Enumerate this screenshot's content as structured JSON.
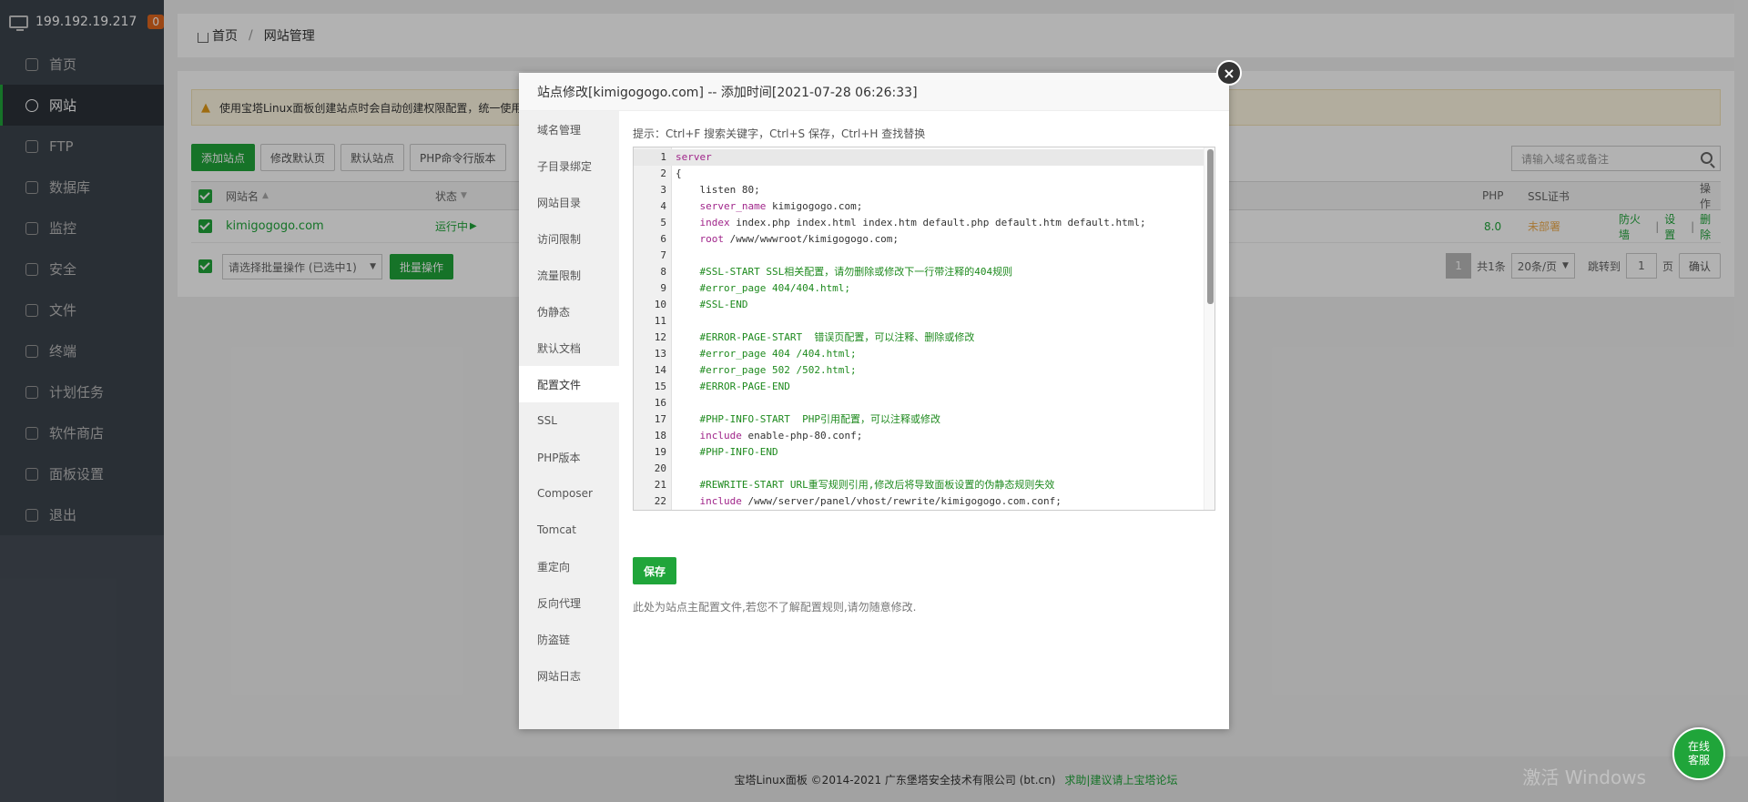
{
  "sidebar": {
    "ip": "199.192.19.217",
    "badge": "0",
    "items": [
      {
        "label": "首页",
        "icon": "home-icon"
      },
      {
        "label": "网站",
        "icon": "globe-icon",
        "active": true
      },
      {
        "label": "FTP",
        "icon": "ftp-icon"
      },
      {
        "label": "数据库",
        "icon": "database-icon"
      },
      {
        "label": "监控",
        "icon": "monitor-icon"
      },
      {
        "label": "安全",
        "icon": "shield-icon"
      },
      {
        "label": "文件",
        "icon": "folder-icon"
      },
      {
        "label": "终端",
        "icon": "terminal-icon"
      },
      {
        "label": "计划任务",
        "icon": "calendar-icon"
      },
      {
        "label": "软件商店",
        "icon": "apps-icon"
      },
      {
        "label": "面板设置",
        "icon": "gear-icon"
      },
      {
        "label": "退出",
        "icon": "logout-icon"
      }
    ]
  },
  "breadcrumb": {
    "home": "首页",
    "current": "网站管理"
  },
  "warning": "使用宝塔Linux面板创建站点时会自动创建权限配置，统一使用",
  "toolbar": {
    "add_site": "添加站点",
    "modify_default_page": "修改默认页",
    "default_site": "默认站点",
    "php_cli_version": "PHP命令行版本"
  },
  "search": {
    "placeholder": "请输入域名或备注"
  },
  "table": {
    "headers": {
      "name": "网站名",
      "status": "状态",
      "php": "PHP",
      "ssl": "SSL证书",
      "ops": "操作"
    },
    "row": {
      "name": "kimigogogo.com",
      "status": "运行中",
      "php": "8.0",
      "ssl": "未部署",
      "firewall": "防火墙",
      "settings": "设置",
      "delete": "删除"
    }
  },
  "batch": {
    "select": "请选择批量操作 (已选中1)",
    "button": "批量操作"
  },
  "pagination": {
    "current": "1",
    "total": "共1条",
    "per_page": "20条/页",
    "goto": "跳转到",
    "page_value": "1",
    "page_unit": "页",
    "confirm": "确认"
  },
  "footer": {
    "copyright": "宝塔Linux面板 ©2014-2021 广东堡塔安全技术有限公司 (bt.cn)",
    "link": "求助|建议请上宝塔论坛"
  },
  "watermark": "激活 Windows",
  "online_service": {
    "line1": "在线",
    "line2": "客服"
  },
  "modal": {
    "title": "站点修改[kimigogogo.com] -- 添加时间[2021-07-28 06:26:33]",
    "close": "×",
    "menu": [
      "域名管理",
      "子目录绑定",
      "网站目录",
      "访问限制",
      "流量限制",
      "伪静态",
      "默认文档",
      "配置文件",
      "SSL",
      "PHP版本",
      "Composer",
      "Tomcat",
      "重定向",
      "反向代理",
      "防盗链",
      "网站日志"
    ],
    "active_menu": "配置文件",
    "hint": "提示：Ctrl+F 搜索关键字，Ctrl+S 保存，Ctrl+H 查找替换",
    "save": "保存",
    "note": "此处为站点主配置文件,若您不了解配置规则,请勿随意修改.",
    "code": [
      {
        "n": "1",
        "parts": [
          {
            "t": "server",
            "c": "kw"
          }
        ]
      },
      {
        "n": "2",
        "parts": [
          {
            "t": "{",
            "c": ""
          }
        ]
      },
      {
        "n": "3",
        "parts": [
          {
            "t": "    listen 80;",
            "c": ""
          }
        ]
      },
      {
        "n": "4",
        "parts": [
          {
            "t": "    ",
            "c": ""
          },
          {
            "t": "server_name",
            "c": "kw"
          },
          {
            "t": " kimigogogo.com;",
            "c": ""
          }
        ]
      },
      {
        "n": "5",
        "parts": [
          {
            "t": "    ",
            "c": ""
          },
          {
            "t": "index",
            "c": "kw"
          },
          {
            "t": " index.php index.html index.htm default.php default.htm default.html;",
            "c": ""
          }
        ]
      },
      {
        "n": "6",
        "parts": [
          {
            "t": "    ",
            "c": ""
          },
          {
            "t": "root",
            "c": "kw"
          },
          {
            "t": " /www/wwwroot/kimigogogo.com;",
            "c": ""
          }
        ]
      },
      {
        "n": "7",
        "parts": [
          {
            "t": "",
            "c": ""
          }
        ]
      },
      {
        "n": "8",
        "parts": [
          {
            "t": "    #SSL-START SSL相关配置，请勿删除或修改下一行带注释的404规则",
            "c": "cm"
          }
        ]
      },
      {
        "n": "9",
        "parts": [
          {
            "t": "    #error_page 404/404.html;",
            "c": "cm"
          }
        ]
      },
      {
        "n": "10",
        "parts": [
          {
            "t": "    #SSL-END",
            "c": "cm"
          }
        ]
      },
      {
        "n": "11",
        "parts": [
          {
            "t": "",
            "c": ""
          }
        ]
      },
      {
        "n": "12",
        "parts": [
          {
            "t": "    #ERROR-PAGE-START  错误页配置，可以注释、删除或修改",
            "c": "cm"
          }
        ]
      },
      {
        "n": "13",
        "parts": [
          {
            "t": "    #error_page 404 /404.html;",
            "c": "cm"
          }
        ]
      },
      {
        "n": "14",
        "parts": [
          {
            "t": "    #error_page 502 /502.html;",
            "c": "cm"
          }
        ]
      },
      {
        "n": "15",
        "parts": [
          {
            "t": "    #ERROR-PAGE-END",
            "c": "cm"
          }
        ]
      },
      {
        "n": "16",
        "parts": [
          {
            "t": "",
            "c": ""
          }
        ]
      },
      {
        "n": "17",
        "parts": [
          {
            "t": "    #PHP-INFO-START  PHP引用配置，可以注释或修改",
            "c": "cm"
          }
        ]
      },
      {
        "n": "18",
        "parts": [
          {
            "t": "    ",
            "c": ""
          },
          {
            "t": "include",
            "c": "kw"
          },
          {
            "t": " enable-php-80.conf;",
            "c": ""
          }
        ]
      },
      {
        "n": "19",
        "parts": [
          {
            "t": "    #PHP-INFO-END",
            "c": "cm"
          }
        ]
      },
      {
        "n": "20",
        "parts": [
          {
            "t": "",
            "c": ""
          }
        ]
      },
      {
        "n": "21",
        "parts": [
          {
            "t": "    #REWRITE-START URL重写规则引用,修改后将导致面板设置的伪静态规则失效",
            "c": "cm"
          }
        ]
      },
      {
        "n": "22",
        "parts": [
          {
            "t": "    ",
            "c": ""
          },
          {
            "t": "include",
            "c": "kw"
          },
          {
            "t": " /www/server/panel/vhost/rewrite/kimigogogo.com.conf;",
            "c": ""
          }
        ]
      }
    ]
  }
}
